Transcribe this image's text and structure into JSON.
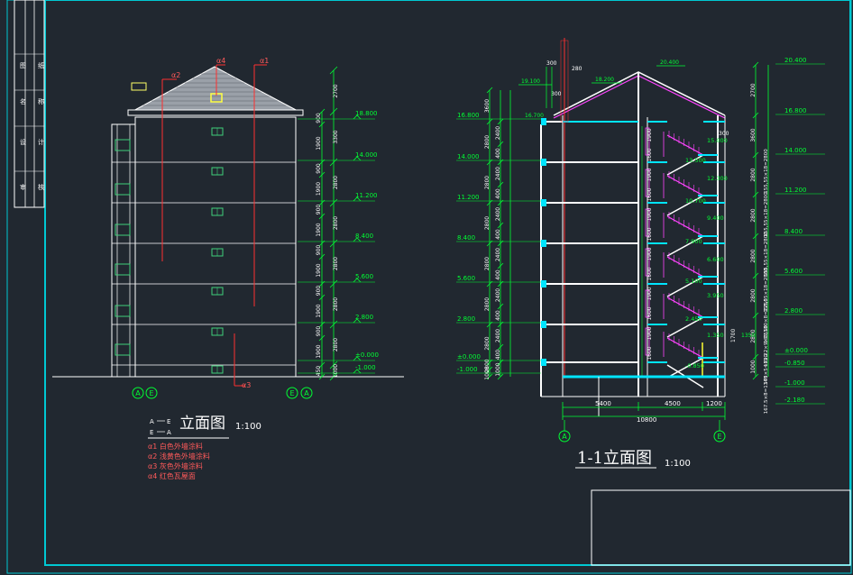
{
  "colors": {
    "background": "#212830",
    "frame": "#00c8d2",
    "dim": "#00ff33",
    "wall": "#ffffff",
    "slab": "#00e5ff",
    "stair": "#ff44ff",
    "note": "#ff5a5a",
    "window": "#3fd07a",
    "red_line": "#ff3030",
    "roof_tile": "#9aa0a8"
  },
  "left_elevation": {
    "title": "立面图",
    "scale": "1:100",
    "axis_left": [
      "A",
      "E"
    ],
    "axis_right": [
      "E",
      "A"
    ],
    "legend_codes": [
      [
        "A",
        "E"
      ],
      [
        "E",
        "A"
      ]
    ],
    "callouts": [
      "α2",
      "α4",
      "α1",
      "α3"
    ],
    "notes": [
      "α1 白色外墙涂料",
      "α2 浅黄色外墙涂料",
      "α3 灰色外墙涂料",
      "α4 红色瓦屋面"
    ],
    "levels": [
      "18.800",
      "14.000",
      "11.200",
      "8.400",
      "5.600",
      "2.800",
      "±0.000",
      "-1.000"
    ],
    "dims_outer": [
      "2700",
      "3300",
      "2800",
      "2800",
      "2800",
      "2800",
      "2800",
      "1000"
    ],
    "dims_inner": [
      "900",
      "1900",
      "900",
      "1900",
      "900",
      "1900",
      "900",
      "1900",
      "900",
      "1900",
      "900",
      "1900",
      "450"
    ]
  },
  "section": {
    "title": "1-1立面图",
    "scale": "1:100",
    "axis_left": "A",
    "axis_right": "E",
    "top_labels": [
      "300",
      "280",
      "300",
      "19.100",
      "18.200",
      "20.400",
      "16.700"
    ],
    "levels_left": [
      "16.800",
      "14.000",
      "11.200",
      "8.400",
      "5.600",
      "2.800",
      "±0.000",
      "-1.000"
    ],
    "levels_right": [
      "20.400",
      "16.800",
      "14.000",
      "11.200",
      "8.400",
      "5.600",
      "2.800",
      "±0.000",
      "-0.850",
      "-1.000",
      "-2.180"
    ],
    "stair_levels": [
      "15.000",
      "13.500",
      "12.300",
      "10.700",
      "9.400",
      "7.900",
      "6.600",
      "5.100",
      "3.950",
      "2.450",
      "1.350",
      "-0.850"
    ],
    "vertical_notes": [
      "155,55×18=2800",
      "155,55×18=2800",
      "155,55×18=2800",
      "155,55×18=2800",
      "135,180×8=1250",
      "172.22×9=1550",
      "175×5=850",
      "167.5×8=1340"
    ],
    "bottom_dims": [
      "5400",
      "4500",
      "1200",
      "10800"
    ],
    "left_dims": [
      "2400",
      "400",
      "2400",
      "400",
      "2400",
      "400",
      "2400",
      "400",
      "2400",
      "400",
      "2400",
      "400",
      "1000"
    ],
    "left_dims2": [
      "3600",
      "2800",
      "2800",
      "2800",
      "2800",
      "2800",
      "2800",
      "2800",
      "1000"
    ],
    "opening_dims": [
      "1900",
      "1600",
      "1900",
      "1600",
      "1900",
      "1600",
      "1900",
      "1600",
      "1900",
      "1600",
      "1900",
      "1600"
    ],
    "right_dims": [
      "2700",
      "3600",
      "2800",
      "2800",
      "2800",
      "2800",
      "2800",
      "1000"
    ],
    "small": [
      "300",
      "1700",
      "1350"
    ]
  },
  "sidebar_labels": [
    "图",
    "纸",
    "名",
    "称",
    "设",
    "计",
    "审",
    "核"
  ]
}
